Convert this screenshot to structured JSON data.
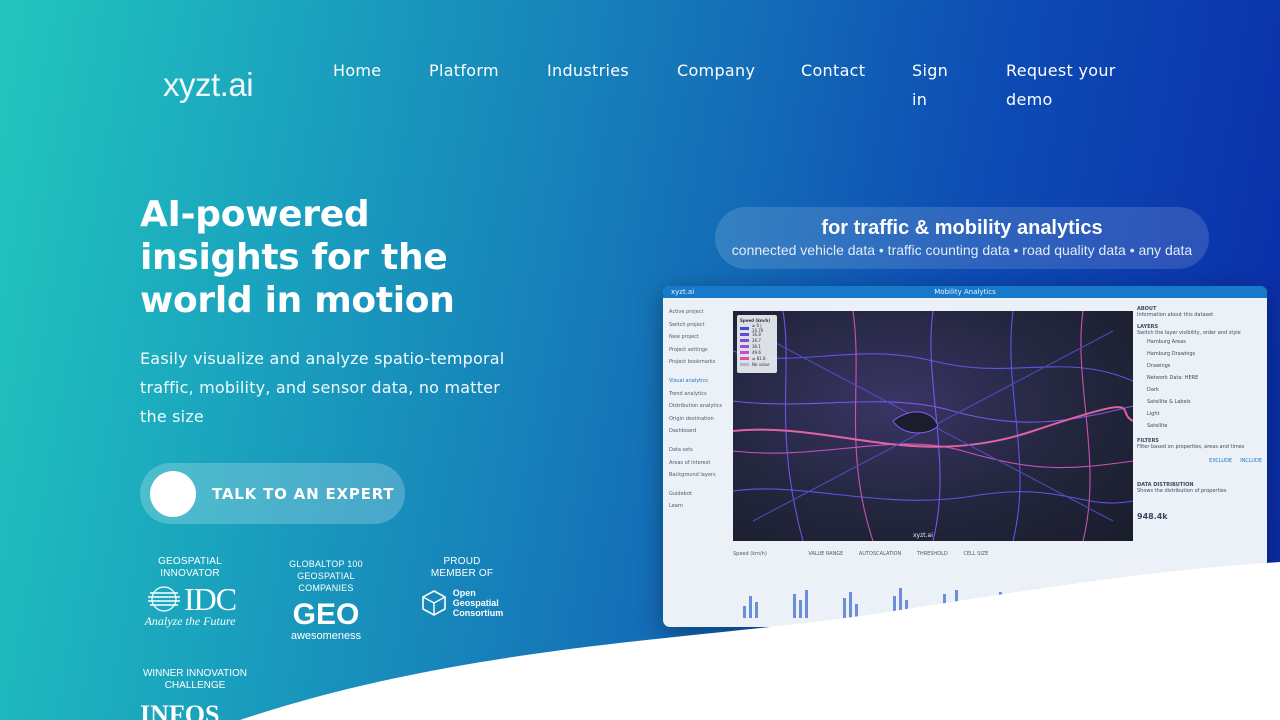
{
  "brand": {
    "logo_text": "xyzt.ai"
  },
  "nav": {
    "items": [
      "Home",
      "Platform",
      "Industries",
      "Company",
      "Contact"
    ],
    "sign_in": [
      "Sign",
      "in"
    ],
    "request_demo": [
      "Request your",
      "demo"
    ]
  },
  "hero": {
    "title": "AI-powered insights for the world in motion",
    "subtitle": "Easily visualize and analyze spatio-temporal traffic, mobility, and sensor data, no matter the size",
    "cta_label": "TALK TO AN EXPERT"
  },
  "badges": {
    "idc": {
      "caption": [
        "GEOSPATIAL",
        "INNOVATOR"
      ],
      "logo": "IDC",
      "tagline": "Analyze the Future"
    },
    "geo": {
      "caption": [
        "GLOBALTOP 100",
        "GEOSPATIAL COMPANIES"
      ],
      "logo": "GEO",
      "tagline": "awesomeness"
    },
    "ogc": {
      "caption": [
        "PROUD",
        "MEMBER OF"
      ],
      "logo_lines": [
        "Open",
        "Geospatial",
        "Consortium"
      ]
    },
    "infos": {
      "caption": [
        "WINNER INNOVATION",
        "CHALLENGE"
      ],
      "logo": "INFOS"
    }
  },
  "tagline": {
    "headline": "for traffic & mobility analytics",
    "sources": "connected vehicle data • traffic counting data • road quality data • any data"
  },
  "app_screenshot": {
    "app_name": "xyzt.ai",
    "title": "Mobility Analytics",
    "sidebar": [
      "Active project",
      "Switch project",
      "New project",
      "Project settings",
      "Project bookmarks",
      "",
      "Visual analytics",
      "Trend analytics",
      "Distribution analytics",
      "Origin destination",
      "Dashboard",
      "",
      "Data sets",
      "Areas of interest",
      "Background layers",
      "",
      "Guidebot",
      "Learn"
    ],
    "legend_title": "Speed (km/h)",
    "legend_rows": [
      {
        "label": "≥ 0 | 14.76",
        "color": "#3b4fc9"
      },
      {
        "label": "16.8",
        "color": "#5a4fd0"
      },
      {
        "label": "26.7",
        "color": "#7a4fd6"
      },
      {
        "label": "36.1",
        "color": "#9b4fd6"
      },
      {
        "label": "49.6",
        "color": "#c24fd0"
      },
      {
        "label": "≥ 81.8",
        "color": "#e24f9a"
      },
      {
        "label": "No value",
        "color": "#b0b8c8"
      }
    ],
    "map_credit": "xyzt.ai",
    "right_panel": {
      "about": "ABOUT",
      "about_sub": "Information about this dataset",
      "layers": "LAYERS",
      "layers_sub": "Switch the layer visibility, order and style",
      "layer_items": [
        "Hamburg Areas",
        "Hamburg Drawings",
        "Drawings",
        "Network Data: HERE",
        "Dark",
        "Satellite & Labels",
        "Light",
        "Satellite"
      ],
      "filters": "FILTERS",
      "filters_sub": "Filter based on properties, areas and times",
      "distribution": "DATA DISTRIBUTION",
      "distribution_sub": "Shows the distribution of properties",
      "exclude": "EXCLUDE",
      "include": "INCLUDE",
      "metric": "948.4k"
    },
    "bottom": [
      "Speed (km/h)",
      "VALUE RANGE",
      "AUTOSCALATION",
      "THRESHOLD",
      "CELL SIZE"
    ]
  }
}
